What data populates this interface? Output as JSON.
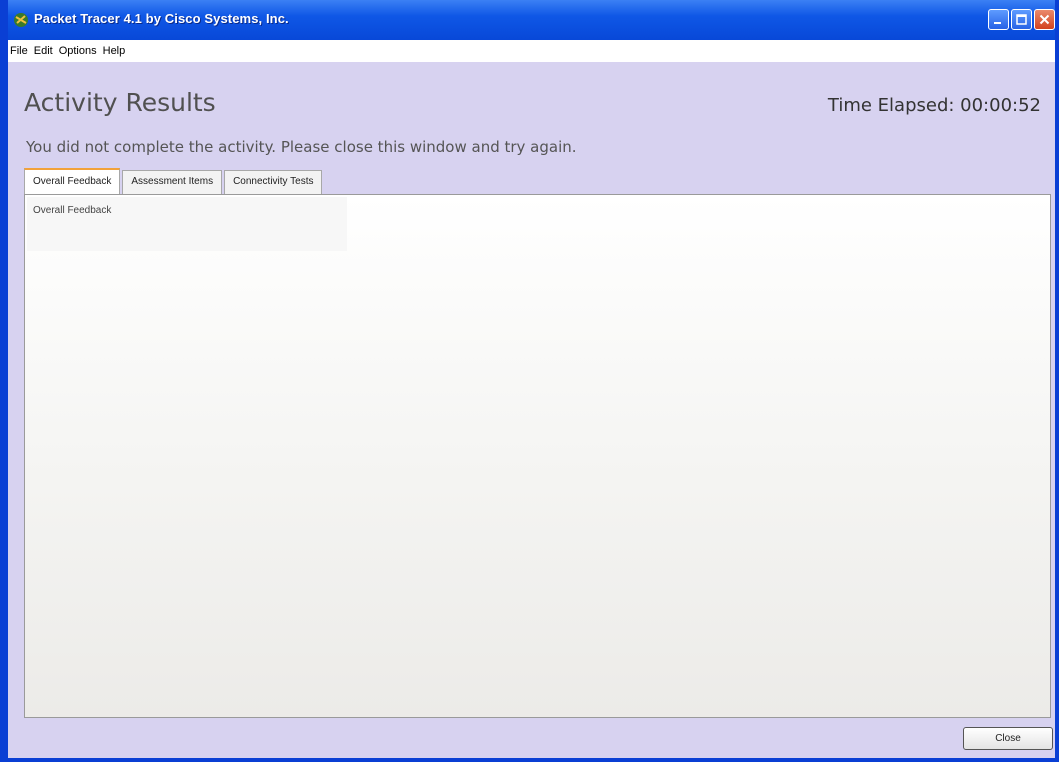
{
  "window": {
    "title": "Packet Tracer 4.1 by Cisco Systems, Inc."
  },
  "menu": {
    "items": [
      "File",
      "Edit",
      "Options",
      "Help"
    ]
  },
  "header": {
    "title": "Activity Results",
    "time_elapsed": "Time Elapsed: 00:00:52"
  },
  "message": "You did not complete the activity. Please close this window and try again.",
  "tabs": [
    {
      "label": "Overall Feedback",
      "active": true
    },
    {
      "label": "Assessment Items",
      "active": false
    },
    {
      "label": "Connectivity Tests",
      "active": false
    }
  ],
  "panel": {
    "content_label": "Overall Feedback"
  },
  "footer": {
    "close_label": "Close"
  },
  "colors": {
    "titlebar": "#0a4fe0",
    "background": "#d7d2f0",
    "active_tab_accent": "#f2a23a"
  },
  "icons": [
    "packet-tracer-icon",
    "minimize-icon",
    "maximize-icon",
    "close-icon"
  ]
}
